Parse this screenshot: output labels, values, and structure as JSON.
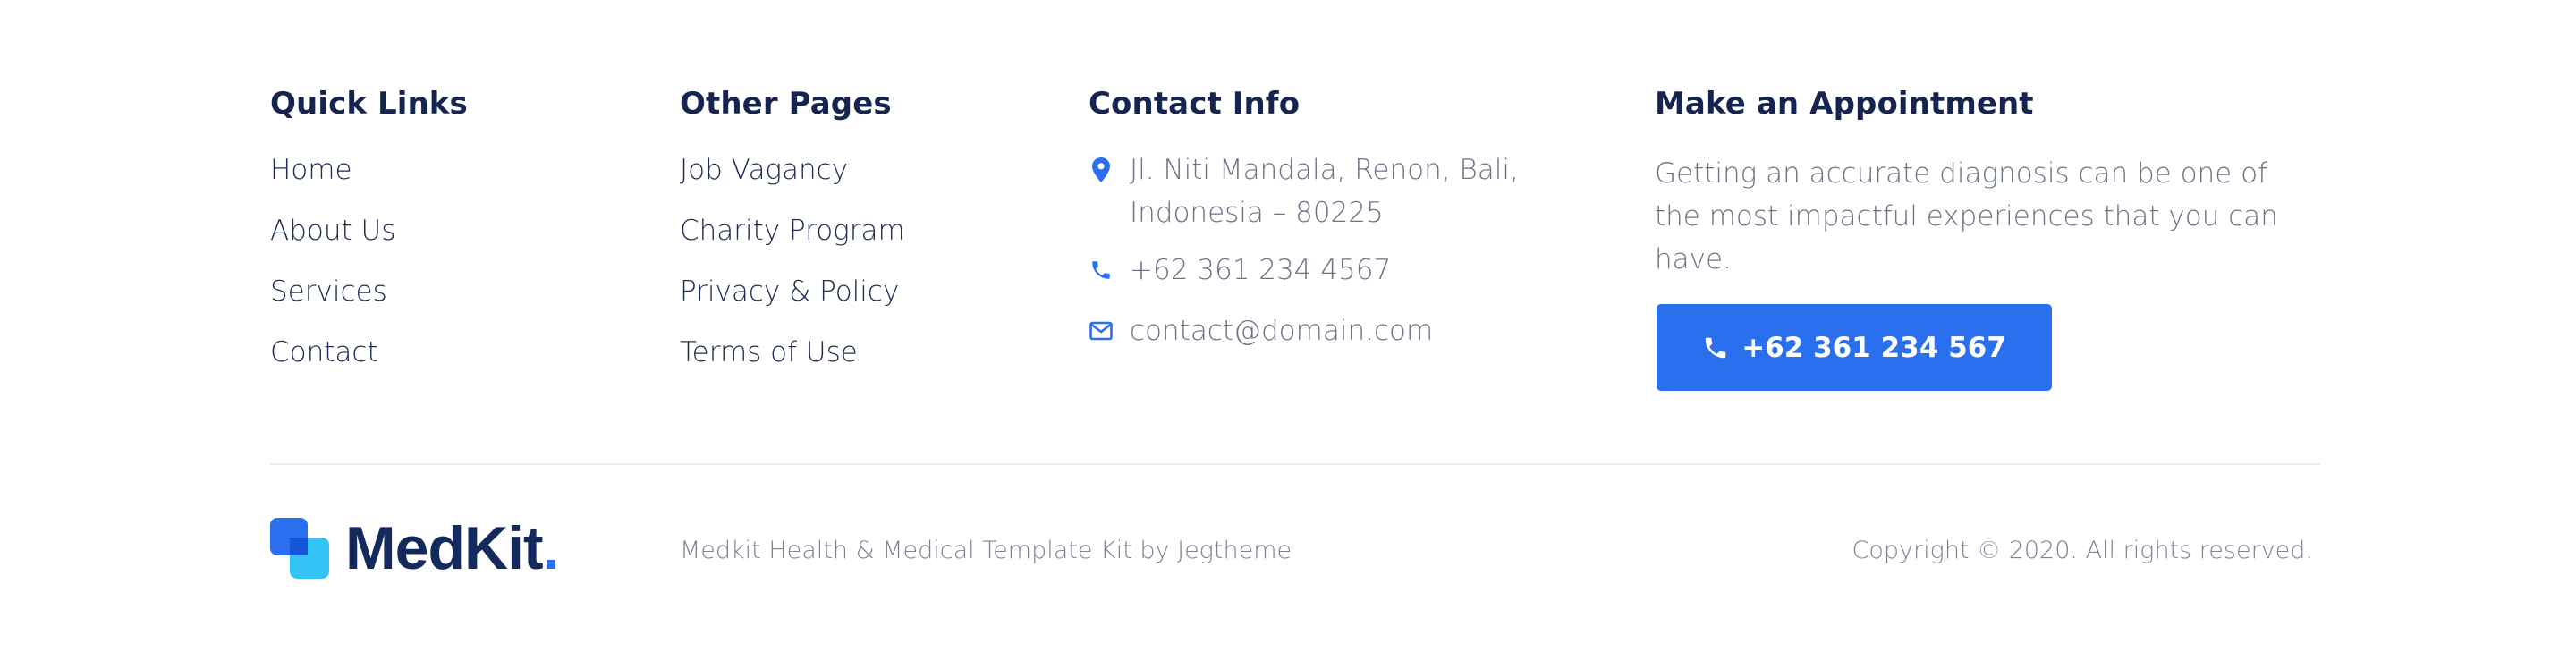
{
  "quick_links": {
    "title": "Quick Links",
    "items": [
      "Home",
      "About Us",
      "Services",
      "Contact"
    ]
  },
  "other_pages": {
    "title": "Other Pages",
    "items": [
      "Job Vagancy",
      "Charity Program",
      "Privacy & Policy",
      "Terms of Use"
    ]
  },
  "contact_info": {
    "title": "Contact Info",
    "address_line1": "Jl. Niti Mandala, Renon, Bali,",
    "address_line2": "Indonesia – 80225",
    "phone": "+62 361 234 4567",
    "email": "contact@domain.com",
    "icons": {
      "address": "map-pin-icon",
      "phone": "phone-icon",
      "email": "envelope-icon"
    }
  },
  "appointment": {
    "title": "Make an Appointment",
    "description": "Getting an accurate diagnosis can be one of the most impactful experiences that you can have.",
    "button_label": "+62 361 234 567",
    "button_icon": "phone-icon"
  },
  "bottom_bar": {
    "logo_text": "MedKit",
    "logo_dot": ".",
    "credit": "Medkit Health & Medical Template Kit by Jegtheme",
    "copyright": "Copyright © 2020. All rights reserved."
  },
  "colors": {
    "accent": "#2a6fed",
    "heading": "#16254f",
    "muted": "#6b7387",
    "logo_light": "#34c3f5",
    "divider": "#e9ebef"
  }
}
